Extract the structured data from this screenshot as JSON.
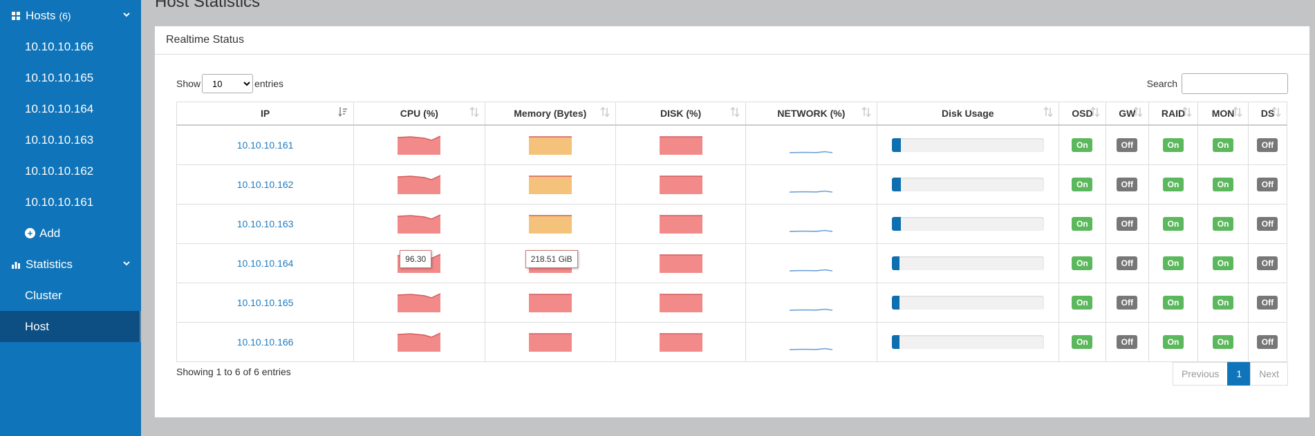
{
  "sidebar": {
    "hosts_label": "Hosts",
    "hosts_count": "(6)",
    "hosts": [
      "10.10.10.166",
      "10.10.10.165",
      "10.10.10.164",
      "10.10.10.163",
      "10.10.10.162",
      "10.10.10.161"
    ],
    "add_label": "Add",
    "statistics_label": "Statistics",
    "stat_items": [
      "Cluster",
      "Host"
    ],
    "active_item": "Host"
  },
  "page": {
    "title": "Host Statistics"
  },
  "panel": {
    "heading": "Realtime Status"
  },
  "controls": {
    "show_label": "Show",
    "entries_value": "10",
    "entries_label": "entries",
    "search_label": "Search",
    "search_value": ""
  },
  "table": {
    "columns": [
      "IP",
      "CPU (%)",
      "Memory (Bytes)",
      "DISK (%)",
      "NETWORK (%)",
      "Disk Usage",
      "OSD",
      "GW",
      "RAID",
      "MON",
      "DS"
    ],
    "rows": [
      {
        "ip": "10.10.10.161",
        "mem_color": "#f4c27a",
        "disk_usage": 0.06,
        "osd": "On",
        "gw": "Off",
        "raid": "On",
        "mon": "On",
        "ds": "Off"
      },
      {
        "ip": "10.10.10.162",
        "mem_color": "#f4c27a",
        "disk_usage": 0.06,
        "osd": "On",
        "gw": "Off",
        "raid": "On",
        "mon": "On",
        "ds": "Off"
      },
      {
        "ip": "10.10.10.163",
        "mem_color": "#f4c27a",
        "disk_usage": 0.06,
        "osd": "On",
        "gw": "Off",
        "raid": "On",
        "mon": "On",
        "ds": "Off"
      },
      {
        "ip": "10.10.10.164",
        "mem_color": "#f28a8a",
        "disk_usage": 0.05,
        "osd": "On",
        "gw": "Off",
        "raid": "On",
        "mon": "On",
        "ds": "Off"
      },
      {
        "ip": "10.10.10.165",
        "mem_color": "#f28a8a",
        "disk_usage": 0.05,
        "osd": "On",
        "gw": "Off",
        "raid": "On",
        "mon": "On",
        "ds": "Off"
      },
      {
        "ip": "10.10.10.166",
        "mem_color": "#f28a8a",
        "disk_usage": 0.05,
        "osd": "On",
        "gw": "Off",
        "raid": "On",
        "mon": "On",
        "ds": "Off"
      }
    ],
    "tooltip_cpu": "96.30",
    "tooltip_mem": "218.51 GiB"
  },
  "footer": {
    "info": "Showing 1 to 6 of 6 entries",
    "previous": "Previous",
    "page": "1",
    "next": "Next"
  },
  "colors": {
    "sidebar": "#0f74b9",
    "active": "#0d4f82",
    "cpu": "#f28a8a",
    "on": "#5cb85c",
    "off": "#777777",
    "link": "#1d7bbf"
  },
  "icons": [
    "grid-icon",
    "chevron-down-icon",
    "plus-circle-icon",
    "bar-chart-icon",
    "sort-icon"
  ]
}
